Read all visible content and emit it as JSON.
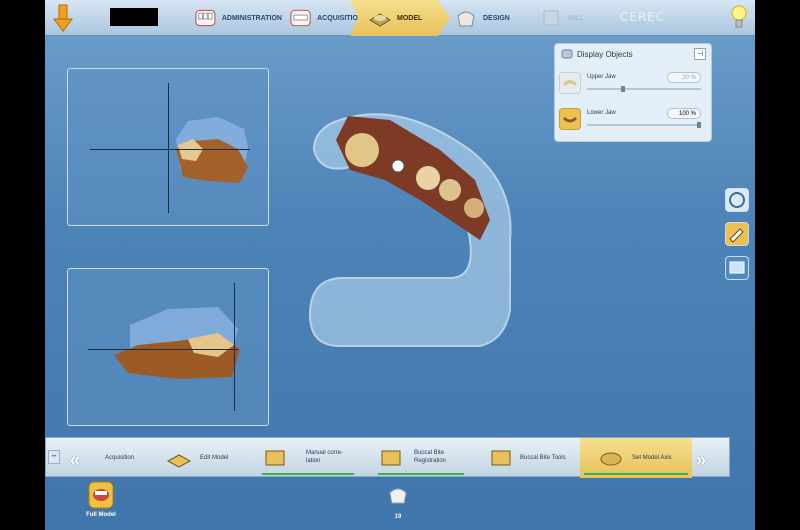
{
  "app": {
    "brand": "CEREC"
  },
  "tabs": [
    {
      "label": "ADMINISTRATION",
      "state": "normal"
    },
    {
      "label": "ACQUISITION",
      "state": "normal"
    },
    {
      "label": "MODEL",
      "state": "active"
    },
    {
      "label": "DESIGN",
      "state": "normal"
    },
    {
      "label": "MILL",
      "state": "disabled"
    }
  ],
  "display_objects": {
    "title": "Display Objects",
    "upper_jaw": {
      "label": "Upper Jaw",
      "value": "30 %"
    },
    "lower_jaw": {
      "label": "Lower Jaw",
      "value": "100 %"
    }
  },
  "steps": [
    {
      "label": "Acquisition"
    },
    {
      "label": "Edit Model"
    },
    {
      "label": "Manual corre-\nlation"
    },
    {
      "label": "Buccal Bite\nRegistration"
    },
    {
      "label": "Buccal Bite Tools"
    },
    {
      "label": "Set Model Axis"
    }
  ],
  "bottom": {
    "full_model_label": "Full Model",
    "tooth_number": "19"
  },
  "colors": {
    "accent": "#e8c15a",
    "progress": "#3ab24a"
  }
}
